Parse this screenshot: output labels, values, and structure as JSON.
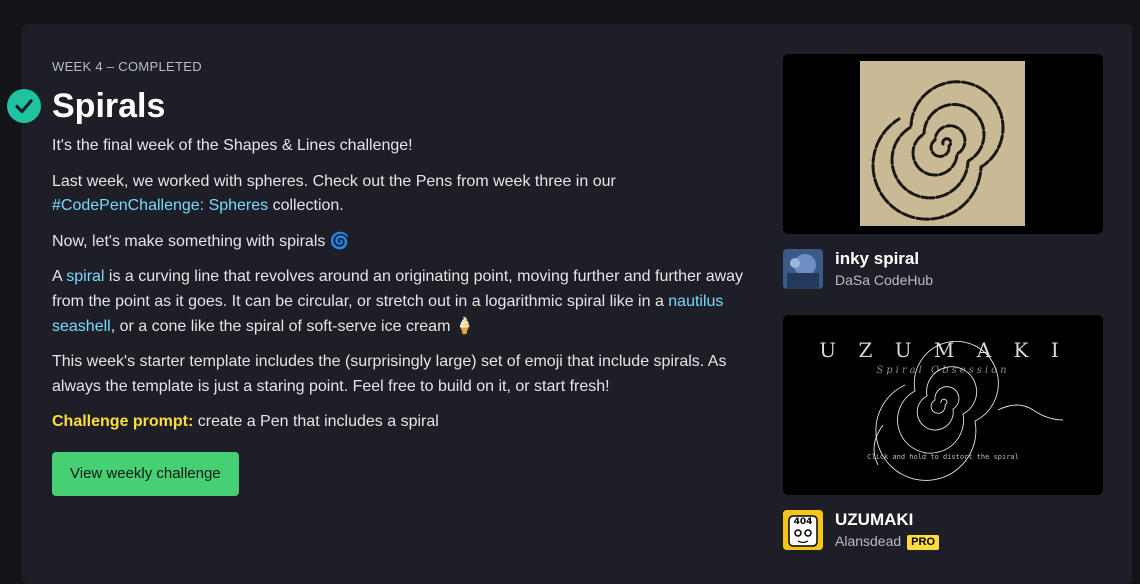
{
  "header": {
    "week_label": "WEEK 4 –  COMPLETED",
    "title": "Spirals"
  },
  "body": {
    "p1": "It's the final week of the Shapes & Lines challenge!",
    "p2_before": "Last week, we worked with spheres. Check out the Pens from week three in our ",
    "p2_link": "#CodePenChallenge: Spheres",
    "p2_after": " collection.",
    "p3": "Now, let's make something with spirals 🌀",
    "p4_a": "A ",
    "p4_link1": "spiral",
    "p4_b": " is a curving line that revolves around an originating point, moving further and further away from the point as it goes. It can be circular, or stretch out in a logarithmic spiral like in a ",
    "p4_link2": "nautilus seashell",
    "p4_c": ", or a cone like the spiral of soft-serve ice cream 🍦",
    "p5": "This week's starter template includes the (surprisingly large) set of emoji that include spirals. As always the template is just a staring point. Feel free to build on it, or start fresh!",
    "prompt_label": "Challenge prompt:",
    "prompt_text": " create a Pen that includes a spiral",
    "button_label": "View weekly challenge"
  },
  "pens": [
    {
      "title": "inky spiral",
      "author": "DaSa CodeHub",
      "pro": false
    },
    {
      "title": "UZUMAKI",
      "author": "Alansdead",
      "pro": true,
      "pro_label": "PRO",
      "preview_title": "U Z U M A K I",
      "preview_subtitle": "Spiral Obsession",
      "preview_hint": "Click and hold to distort the spiral",
      "avatar_text": "404"
    }
  ],
  "colors": {
    "accent_green": "#47cf73",
    "check_teal": "#1ec4a0",
    "link": "#76daff",
    "prompt": "#ffdd40"
  }
}
